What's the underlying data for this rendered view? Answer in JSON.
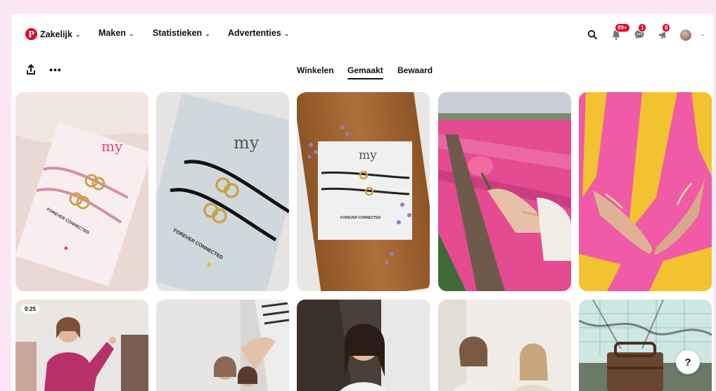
{
  "nav": {
    "logo_glyph": "P",
    "items": [
      {
        "label": "Zakelijk"
      },
      {
        "label": "Maken"
      },
      {
        "label": "Statistieken"
      },
      {
        "label": "Advertenties"
      }
    ],
    "chevron": "⌄"
  },
  "header_icons": {
    "search": "search-icon",
    "notifications_badge": "99+",
    "messages_badge": "1",
    "updates_badge": "8"
  },
  "toolbar": {
    "more_label": "•••",
    "tabs": [
      {
        "label": "Winkelen"
      },
      {
        "label": "Gemaakt"
      },
      {
        "label": "Bewaard"
      }
    ],
    "active_tab": "Gemaakt"
  },
  "pins": {
    "card_brand": "my",
    "card_caption": "FOREVER CONNECTED",
    "video_duration": "0:25"
  },
  "help": {
    "label": "?"
  },
  "colors": {
    "brand_red": "#e60023",
    "page_border_pink": "#fbe7f3"
  }
}
